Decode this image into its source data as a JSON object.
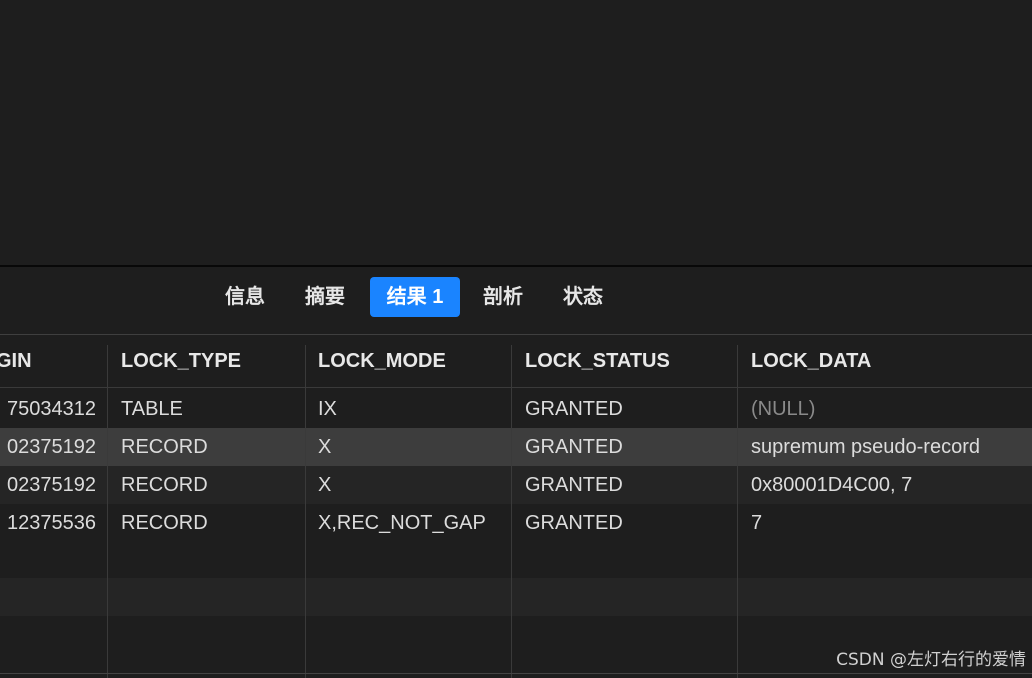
{
  "tabs": [
    {
      "label": "信息",
      "active": false
    },
    {
      "label": "摘要",
      "active": false
    },
    {
      "label": "结果 1",
      "active": true
    },
    {
      "label": "剖析",
      "active": false
    },
    {
      "label": "状态",
      "active": false
    }
  ],
  "columns": [
    "GIN",
    "LOCK_TYPE",
    "LOCK_MODE",
    "LOCK_STATUS",
    "LOCK_DATA"
  ],
  "rows": [
    [
      "75034312",
      "TABLE",
      "IX",
      "GRANTED",
      "(NULL)"
    ],
    [
      "02375192",
      "RECORD",
      "X",
      "GRANTED",
      "supremum pseudo-record"
    ],
    [
      "02375192",
      "RECORD",
      "X",
      "GRANTED",
      "0x80001D4C00, 7"
    ],
    [
      "12375536",
      "RECORD",
      "X,REC_NOT_GAP",
      "GRANTED",
      "7"
    ]
  ],
  "selected_row": 1,
  "watermark": "CSDN @左灯右行的爱情",
  "colors": {
    "accent": "#1a84ff",
    "background": "#1e1e1e",
    "selected_row": "#3d3d3d",
    "null_text": "#8a8a8a"
  }
}
